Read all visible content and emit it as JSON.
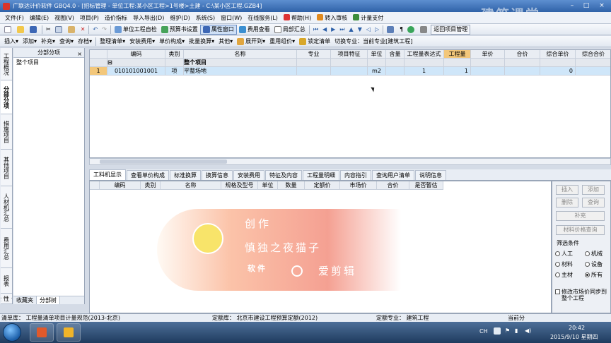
{
  "window": {
    "title": "广联达计价软件 GBQ4.0 - [招标管理 - 单位工程:某小区工程>1号楼>土建 - C:\\某小区工程.GZB4]"
  },
  "watermark_logo": "建筑课堂",
  "menu": [
    "文件(F)",
    "编辑(E)",
    "视图(V)",
    "项目(P)",
    "造价指标",
    "导入导出(D)",
    "维护(D)",
    "系统(S)",
    "窗口(W)",
    "在线服务(L)",
    "帮助(H)",
    "转入审核",
    "计量支付"
  ],
  "toolbar1": {
    "items": [
      "单位工程自检",
      "预算书设置",
      "属性窗口",
      "费用查看",
      "局部汇总",
      "返回项目管理"
    ]
  },
  "toolbar2": {
    "items": [
      "插入",
      "添加",
      "补充",
      "查询",
      "存档",
      "整理清单",
      "安装费用",
      "单价构成",
      "批量换算",
      "其他",
      "展开到",
      "重用组价",
      "锁定清单",
      "切换专业：当前专业[建筑工程]"
    ]
  },
  "vertical_tabs": [
    "工程概况",
    "分部分项",
    "措施项目",
    "其他项目",
    "人材机汇总",
    "费用汇总",
    "报表",
    "符合性检查"
  ],
  "left_pane": {
    "header": "分部分项",
    "close": "×",
    "item": "整个项目",
    "tabs": [
      "收藏夹",
      "分部树"
    ]
  },
  "grid": {
    "columns": [
      "",
      "编码",
      "类别",
      "名称",
      "专业",
      "项目特征",
      "单位",
      "含量",
      "工程量表达式",
      "工程量",
      "单价",
      "合价",
      "综合单价",
      "综合合价"
    ],
    "section_row": [
      "",
      "⊟",
      "",
      "整个项目",
      "",
      "",
      "",
      "",
      "",
      "",
      "",
      "",
      "",
      ""
    ],
    "rows": [
      [
        "1",
        "010101001001",
        "项",
        "平整场地",
        "",
        "",
        "m2",
        "",
        "1",
        "1",
        "",
        "",
        "0",
        ""
      ]
    ]
  },
  "bottom_tabs": [
    "工料机显示",
    "查看单价构成",
    "标准换算",
    "换算信息",
    "安装费用",
    "特征及内容",
    "工程量明细",
    "内容指引",
    "查询用户清单",
    "说明信息"
  ],
  "bottom_grid": {
    "columns": [
      "编码",
      "类别",
      "名称",
      "规格及型号",
      "单位",
      "数量",
      "定额价",
      "市场价",
      "合价",
      "是否暂估"
    ]
  },
  "right_panel": {
    "buttons": [
      "插入",
      "添加",
      "删除",
      "查询",
      "补充",
      "材料价格查询"
    ],
    "filter_title": "筛选条件",
    "filters": [
      {
        "label": "人工",
        "checked": false
      },
      {
        "label": "机械",
        "checked": false
      },
      {
        "label": "材料",
        "checked": false
      },
      {
        "label": "设备",
        "checked": false
      },
      {
        "label": "主材",
        "checked": false
      },
      {
        "label": "所有",
        "checked": true
      }
    ],
    "sync_label": "修改市场价同步到整个工程"
  },
  "status": {
    "list_lib": "清单库： 工程量清单项目计量规范(2013-北京)",
    "quota_lib": "定额库： 北京市建设工程预算定额(2012)",
    "quota_major": "定额专业： 建筑工程",
    "current": "当前分"
  },
  "watermark": {
    "line1": "创作",
    "line2": "慎独之夜猫子",
    "line3a": "软件",
    "line3b": "爱剪辑"
  },
  "taskbar": {
    "lang": "CH",
    "time": "20:42",
    "date": "2015/9/10 星期四"
  },
  "colors": {
    "title_bar": "#3a6db5",
    "highlight_column": "#f3c77a",
    "selected_row": "#cfe6f9",
    "watermark_accent": "#f07864"
  }
}
